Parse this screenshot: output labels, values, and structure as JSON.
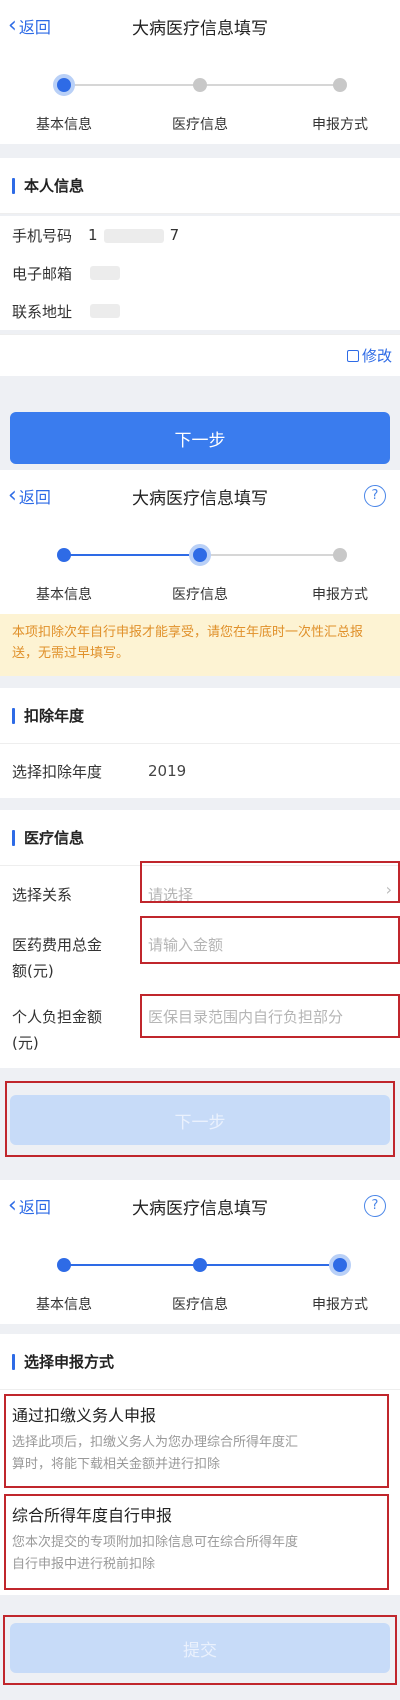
{
  "header": {
    "back_label": "返回",
    "title": "大病医疗信息填写",
    "help": "?"
  },
  "steps": [
    "基本信息",
    "医疗信息",
    "申报方式"
  ],
  "screen1": {
    "section_title": "本人信息",
    "fields": [
      {
        "label": "手机号码",
        "value_start": "1",
        "value_end": "7"
      },
      {
        "label": "电子邮箱"
      },
      {
        "label": "联系地址"
      }
    ],
    "edit_label": "修改",
    "next_label": "下一步"
  },
  "screen2": {
    "notice": "本项扣除次年自行申报才能享受，请您在年底时一次性汇总报送，无需过早填写。",
    "year_section": "扣除年度",
    "year_label": "选择扣除年度",
    "year_value": "2019",
    "med_section": "医疗信息",
    "relation_label": "选择关系",
    "relation_placeholder": "请选择",
    "total_label_1": "医药费用总金",
    "total_label_2": "额(元)",
    "total_placeholder": "请输入金额",
    "personal_label_1": "个人负担金额",
    "personal_label_2": "(元)",
    "personal_placeholder": "医保目录范围内自行负担部分",
    "next_label": "下一步"
  },
  "screen3": {
    "section_title": "选择申报方式",
    "option1_title": "通过扣缴义务人申报",
    "option1_desc_1": "选择此项后，扣缴义务人为您办理综合所得年度汇",
    "option1_desc_2": "算时，将能下载相关金额并进行扣除",
    "option2_title": "综合所得年度自行申报",
    "option2_desc_1": "您本次提交的专项附加扣除信息可在综合所得年度",
    "option2_desc_2": "自行申报中进行税前扣除",
    "submit_label": "提交"
  },
  "colors": {
    "accent": "#2e6be6",
    "button": "#3a7cee",
    "button_disabled": "#c7dbf8",
    "highlight_box": "#c0262c",
    "notice_bg": "#fdf3d3",
    "notice_text": "#e0902a"
  }
}
